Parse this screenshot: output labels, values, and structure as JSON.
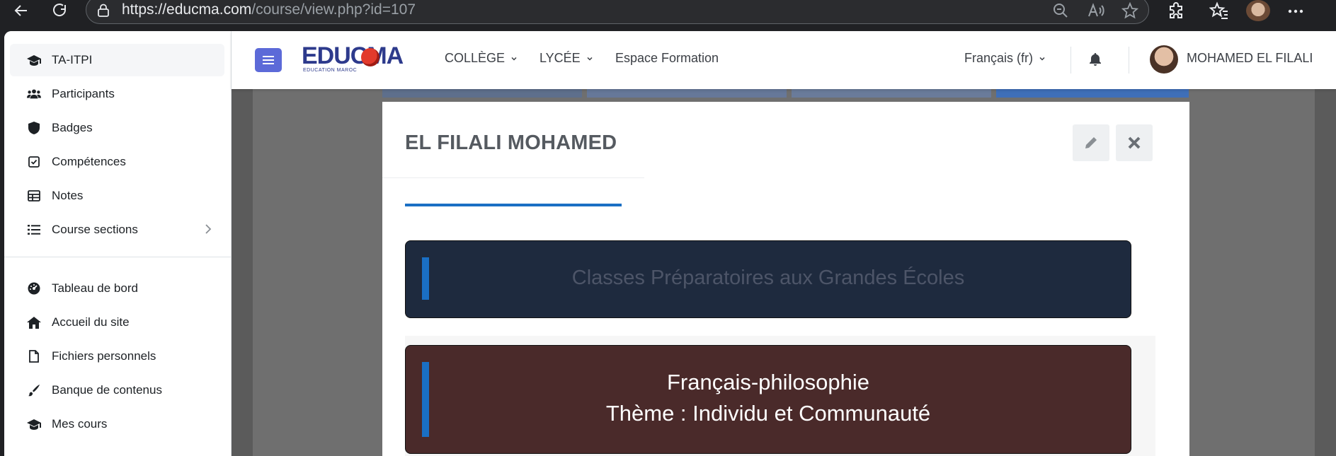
{
  "browser": {
    "url_host": "https://educma.com",
    "url_path": "/course/view.php?id=107"
  },
  "drawer": {
    "course_items": [
      {
        "label": "TA-ITPI",
        "icon": "graduation-cap-icon"
      },
      {
        "label": "Participants",
        "icon": "users-icon"
      },
      {
        "label": "Badges",
        "icon": "shield-icon"
      },
      {
        "label": "Compétences",
        "icon": "checkbox-icon"
      },
      {
        "label": "Notes",
        "icon": "table-icon"
      },
      {
        "label": "Course sections",
        "icon": "list-icon"
      }
    ],
    "site_items": [
      {
        "label": "Tableau de bord",
        "icon": "dashboard-icon"
      },
      {
        "label": "Accueil du site",
        "icon": "home-icon"
      },
      {
        "label": "Fichiers personnels",
        "icon": "file-icon"
      },
      {
        "label": "Banque de contenus",
        "icon": "paint-brush-icon"
      },
      {
        "label": "Mes cours",
        "icon": "graduation-cap-icon"
      }
    ]
  },
  "navbar": {
    "logo_text": "EDUCMA",
    "logo_sub": "EDUCATION MAROC",
    "links": [
      "COLLÈGE",
      "LYCÉE",
      "Espace Formation"
    ],
    "language": "Français (fr)",
    "user_name": "MOHAMED EL FILALI"
  },
  "modal": {
    "title": "EL FILALI MOHAMED",
    "banner1_text": "Classes Préparatoires aux Grandes Écoles",
    "banner2_line1": "Français-philosophie",
    "banner2_line2": "Thème : Individu et Communauté"
  },
  "colors": {
    "accent_blue": "#1a6fc4",
    "hamburger": "#5c6ad8",
    "banner1_bg": "#1e2a3e",
    "banner2_bg": "#4a2a2a"
  }
}
